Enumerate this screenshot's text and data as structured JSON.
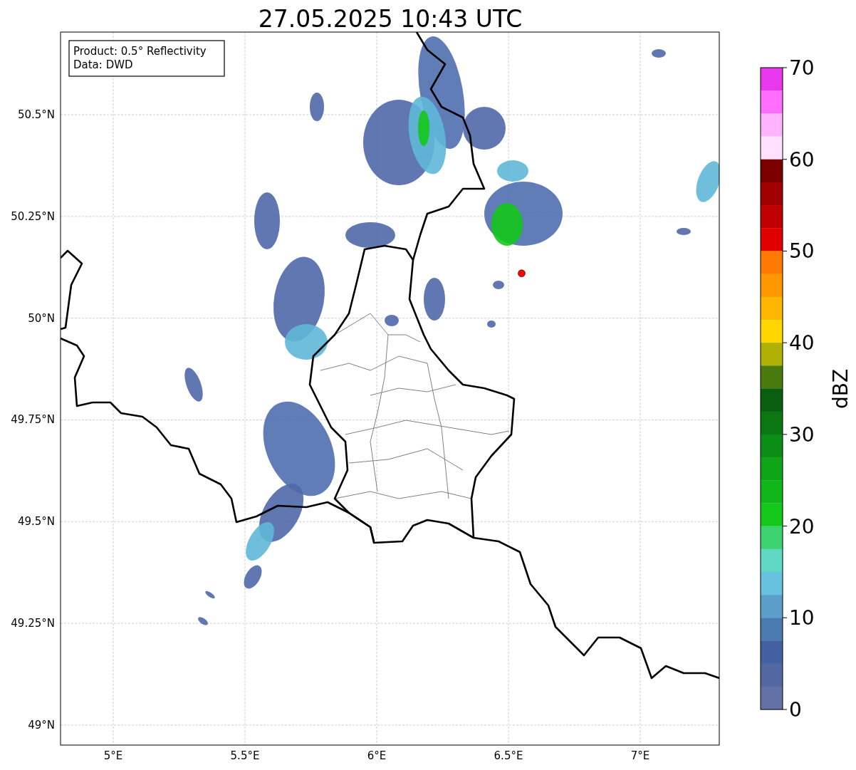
{
  "title": "27.05.2025 10:43 UTC",
  "info_box": [
    "Product: 0.5° Reflectivity",
    "Data: DWD"
  ],
  "map": {
    "x_ticks": [
      "5°E",
      "5.5°E",
      "6°E",
      "6.5°E",
      "7°E"
    ],
    "y_ticks": [
      "50.5°N",
      "50.25°N",
      "50°N",
      "49.75°N",
      "49.5°N",
      "49.25°N",
      "49°N"
    ],
    "marker": {
      "color": "#ff0000"
    }
  },
  "colorbar": {
    "label": "dBZ",
    "ticks": [
      "70",
      "60",
      "50",
      "40",
      "30",
      "20",
      "10",
      "0"
    ],
    "segments": [
      {
        "color": "#e838ee"
      },
      {
        "color": "#ff6eff"
      },
      {
        "color": "#ffb4ff"
      },
      {
        "color": "#ffe0ff"
      },
      {
        "color": "#7a0000"
      },
      {
        "color": "#a00000"
      },
      {
        "color": "#c00000"
      },
      {
        "color": "#e00000"
      },
      {
        "color": "#ff7a00"
      },
      {
        "color": "#ff9800"
      },
      {
        "color": "#ffb600"
      },
      {
        "color": "#ffd600"
      },
      {
        "color": "#b0b006"
      },
      {
        "color": "#4a7a0e"
      },
      {
        "color": "#0a5e10"
      },
      {
        "color": "#0a7713"
      },
      {
        "color": "#0b8e16"
      },
      {
        "color": "#0ea519"
      },
      {
        "color": "#10b61a"
      },
      {
        "color": "#14c81a"
      },
      {
        "color": "#3dd370"
      },
      {
        "color": "#5fd8c5"
      },
      {
        "color": "#66c2df"
      },
      {
        "color": "#5a9ec9"
      },
      {
        "color": "#4b7ab1"
      },
      {
        "color": "#4260a2"
      },
      {
        "color": "#5368a0"
      },
      {
        "color": "#6372a6"
      }
    ]
  }
}
